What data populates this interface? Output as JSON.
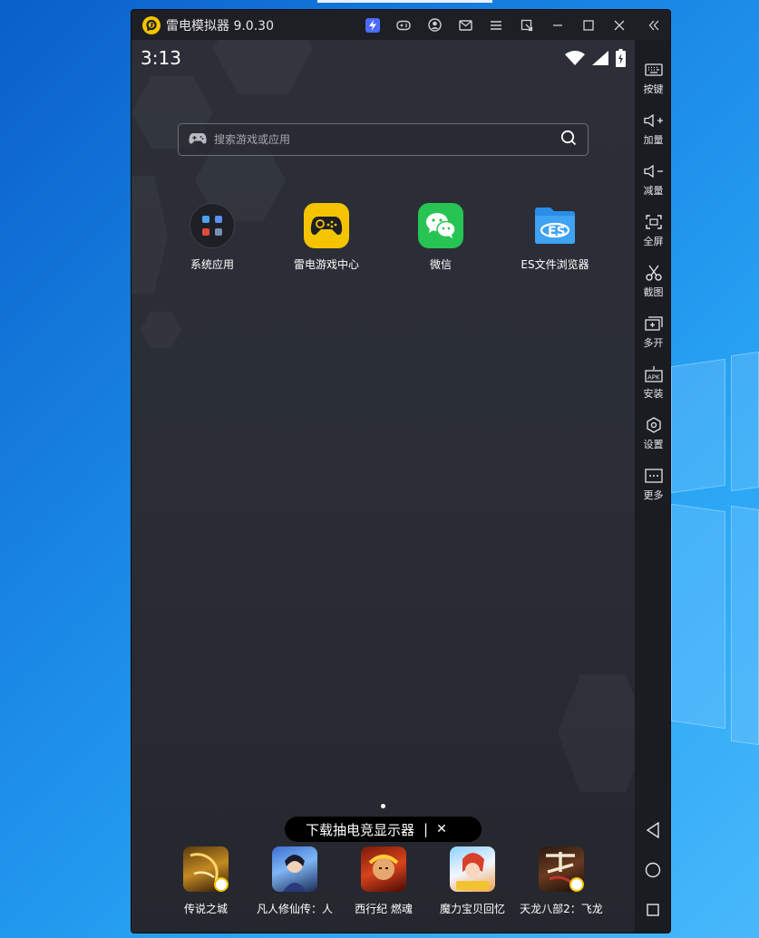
{
  "window": {
    "title": "雷电模拟器 9.0.30",
    "logo_icon": "leidian-logo-icon",
    "title_icons": [
      "boost-icon",
      "gamepad-icon",
      "user-icon",
      "mail-icon",
      "menu-icon",
      "restore-small-icon",
      "minimize-icon",
      "maximize-icon",
      "close-icon",
      "collapse-sidebar-icon"
    ]
  },
  "statusbar": {
    "time": "3:13",
    "icons": [
      "wifi-icon",
      "signal-icon",
      "battery-icon"
    ]
  },
  "search": {
    "placeholder": "搜索游戏或应用"
  },
  "apps": [
    {
      "label": "系统应用",
      "icon": "system-apps-folder-icon"
    },
    {
      "label": "雷电游戏中心",
      "icon": "game-center-icon"
    },
    {
      "label": "微信",
      "icon": "wechat-icon"
    },
    {
      "label": "ES文件浏览器",
      "icon": "es-file-explorer-icon"
    }
  ],
  "promo": {
    "text": "下载抽电竞显示器",
    "separator": "|",
    "close": "✕"
  },
  "dock": [
    {
      "label": "传说之城"
    },
    {
      "label": "凡人修仙传：人"
    },
    {
      "label": "西行纪 燃魂"
    },
    {
      "label": "魔力宝贝回忆"
    },
    {
      "label": "天龙八部2：飞龙"
    }
  ],
  "sidebar": {
    "items": [
      {
        "label": "按键",
        "icon": "keyboard-icon"
      },
      {
        "label": "加量",
        "icon": "volume-up-icon"
      },
      {
        "label": "减量",
        "icon": "volume-down-icon"
      },
      {
        "label": "全屏",
        "icon": "fullscreen-icon"
      },
      {
        "label": "截图",
        "icon": "scissors-icon"
      },
      {
        "label": "多开",
        "icon": "multi-instance-icon"
      },
      {
        "label": "安装",
        "icon": "apk-install-icon"
      },
      {
        "label": "设置",
        "icon": "settings-icon"
      },
      {
        "label": "更多",
        "icon": "more-icon"
      }
    ],
    "nav": [
      "back-icon",
      "home-icon",
      "recents-icon"
    ]
  },
  "colors": {
    "accent": "#f5c400",
    "screen_bg": "#2b2e36",
    "sidebar_bg": "#1b1c22",
    "wechat_green": "#27c453",
    "es_blue": "#2a8de8"
  }
}
